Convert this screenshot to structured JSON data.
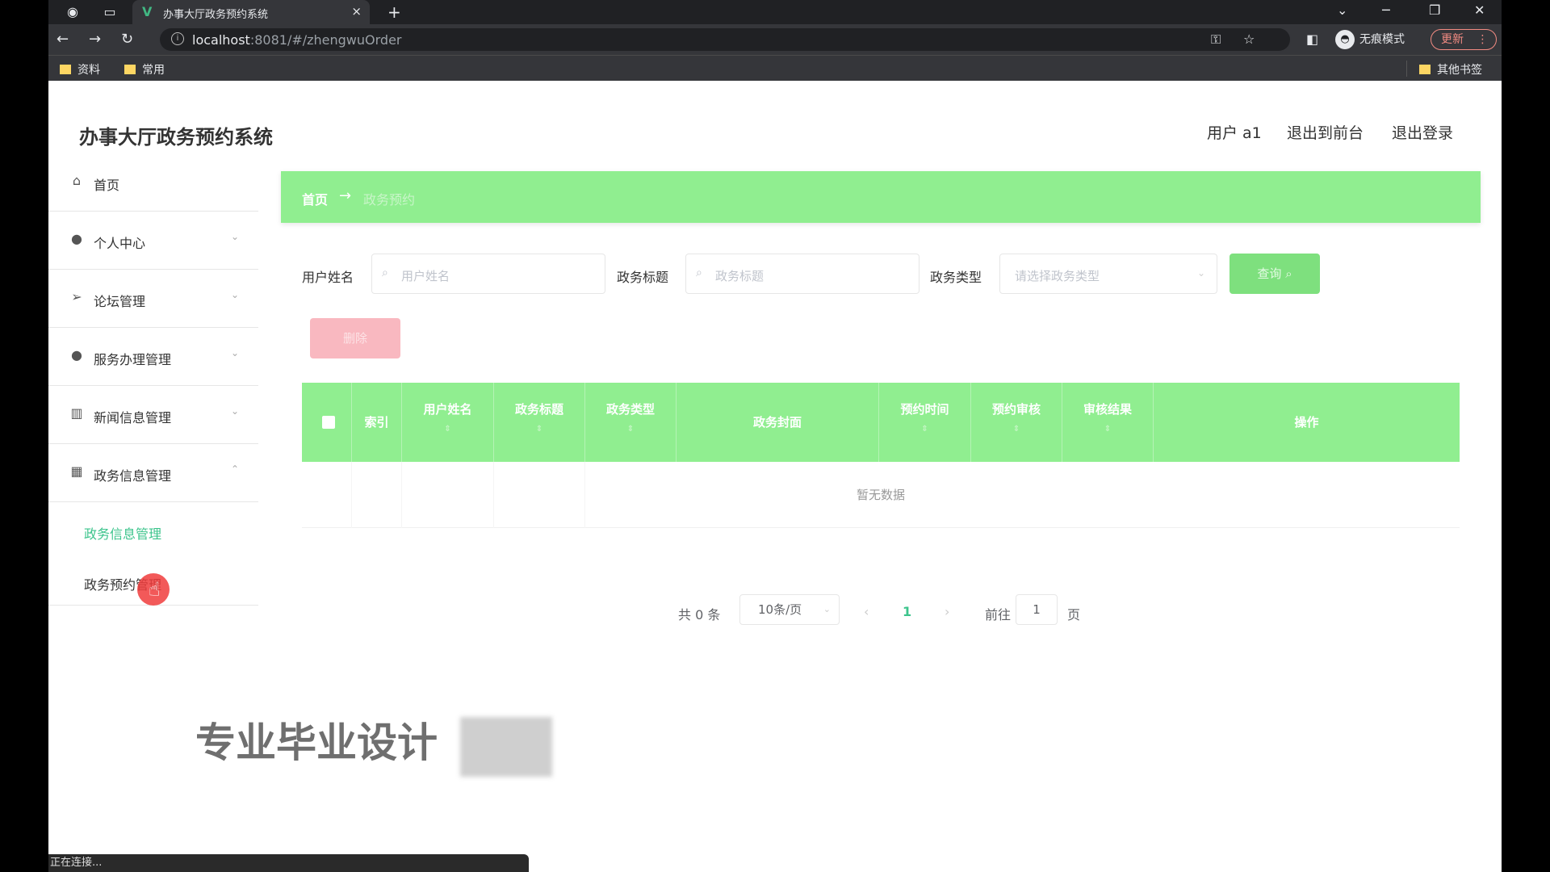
{
  "browser": {
    "tab_title": "办事大厅政务预约系统",
    "tab_close": "×",
    "new_tab": "+",
    "url_host": "localhost",
    "url_rest": ":8081/#/zhengwuOrder",
    "incognito_label": "无痕模式",
    "update_label": "更新",
    "bookmarks": [
      "资料",
      "常用"
    ],
    "other_bookmarks": "其他书签"
  },
  "header": {
    "app_title": "办事大厅政务预约系统",
    "user": "用户 a1",
    "back_to_front": "退出到前台",
    "logout": "退出登录"
  },
  "sidebar": {
    "items": [
      {
        "label": "首页",
        "icon": "home-icon"
      },
      {
        "label": "个人中心",
        "icon": "user-icon"
      },
      {
        "label": "论坛管理",
        "icon": "send-icon"
      },
      {
        "label": "服务办理管理",
        "icon": "user-icon"
      },
      {
        "label": "新闻信息管理",
        "icon": "chart-icon"
      },
      {
        "label": "政务信息管理",
        "icon": "grid-icon"
      }
    ],
    "sub_items": [
      "政务信息管理",
      "政务预约管理"
    ]
  },
  "breadcrumb": {
    "home": "首页",
    "current": "政务预约"
  },
  "filters": {
    "username_label": "用户姓名",
    "username_placeholder": "用户姓名",
    "title_label": "政务标题",
    "title_placeholder": "政务标题",
    "type_label": "政务类型",
    "type_placeholder": "请选择政务类型",
    "query_button": "查询",
    "delete_button": "删除"
  },
  "table": {
    "columns": [
      "索引",
      "用户姓名",
      "政务标题",
      "政务类型",
      "政务封面",
      "预约时间",
      "预约审核",
      "审核结果",
      "操作"
    ],
    "empty_text": "暂无数据"
  },
  "pagination": {
    "total": "共 0 条",
    "page_size": "10条/页",
    "current_page": "1",
    "goto_prefix": "前往",
    "goto_value": "1",
    "goto_suffix": "页"
  },
  "watermark": "专业毕业设计",
  "status_text": "正在连接...",
  "colors": {
    "accent": "#90ee90",
    "active_submenu": "#3cc48c",
    "delete": "#f9b8c0"
  }
}
